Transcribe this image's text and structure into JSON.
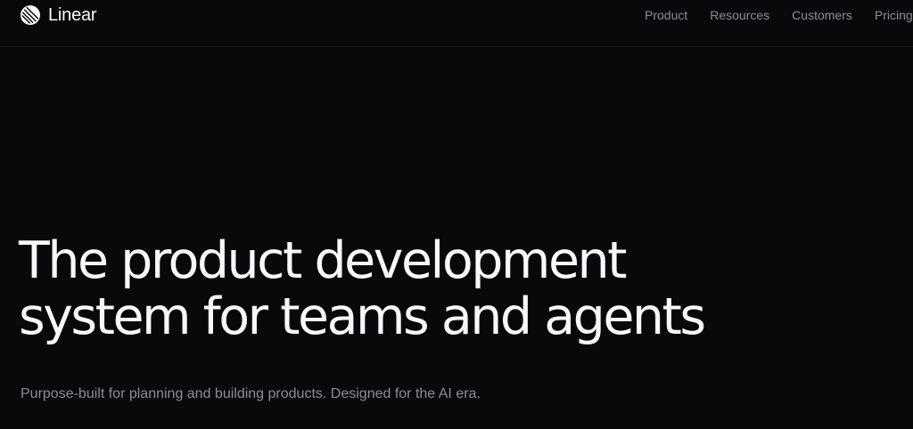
{
  "header": {
    "brand_name": "Linear",
    "brand_icon": "linear-logo-icon",
    "nav_items": [
      "Product",
      "Resources",
      "Customers",
      "Pricing"
    ]
  },
  "hero": {
    "title_line1": "The product development",
    "title_line2": "system for teams and agents",
    "subtitle": "Purpose-built for planning and building products. Designed for the AI era."
  },
  "colors": {
    "background": "#08090a",
    "text_primary": "#f7f8f8",
    "text_secondary": "#8a8f98"
  }
}
